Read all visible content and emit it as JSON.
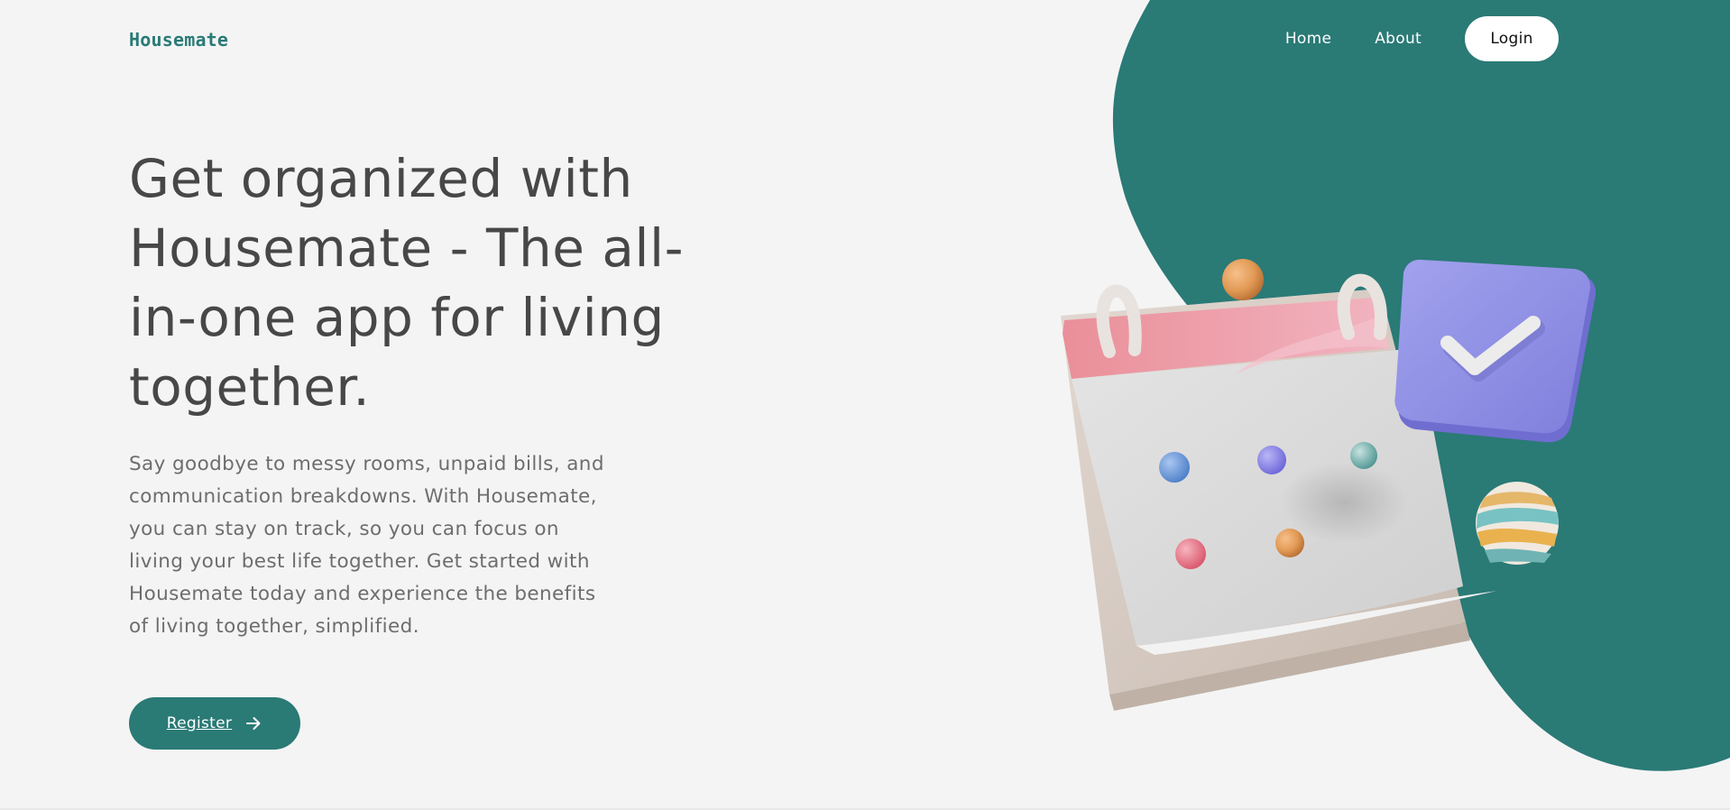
{
  "header": {
    "brand": "Housemate",
    "nav": {
      "home": "Home",
      "about": "About",
      "login": "Login"
    }
  },
  "hero": {
    "title": "Get organized with Housemate - The all-in-one app for living together.",
    "description": "Say goodbye to messy rooms, unpaid bills, and communication breakdowns. With Housemate, you can stay on track, so you can focus on living your best life together. Get started with Housemate today and experience the benefits of living together, simplified.",
    "register_label": "Register",
    "register_icon": "arrow-right-icon"
  },
  "illustration": {
    "icons": [
      "calendar-icon",
      "checkmark-badge-icon",
      "orange-sphere-icon",
      "striped-sphere-icon"
    ]
  },
  "colors": {
    "accent": "#2a7a76",
    "background": "#f4f4f4",
    "heading": "#474747",
    "body_text": "#6d6d6d",
    "check_badge": "#8e8fe3",
    "calendar_top": "#e89aa4"
  }
}
